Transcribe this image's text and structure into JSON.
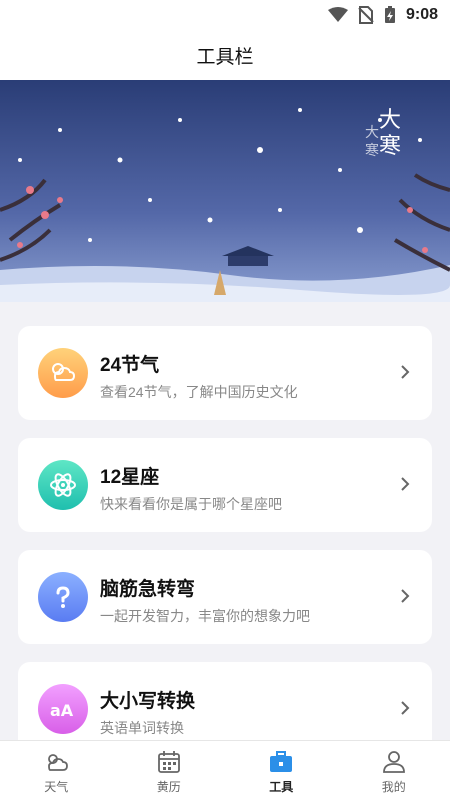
{
  "status_bar": {
    "time": "9:08"
  },
  "header": {
    "title": "工具栏"
  },
  "banner": {
    "text_main": "大寒",
    "text_side": "大寒"
  },
  "tools": [
    {
      "title": "24节气",
      "subtitle": "查看24节气，了解中国历史文化",
      "icon": "weather-cloud-icon",
      "color_top": "#ffd27a",
      "color_bottom": "#ff9c4a"
    },
    {
      "title": "12星座",
      "subtitle": "快来看看你是属于哪个星座吧",
      "icon": "atom-icon",
      "color_top": "#5ee6c5",
      "color_bottom": "#1fbfae"
    },
    {
      "title": "脑筋急转弯",
      "subtitle": "一起开发智力，丰富你的想象力吧",
      "icon": "question-icon",
      "color_top": "#8bb0ff",
      "color_bottom": "#5a7cf2"
    },
    {
      "title": "大小写转换",
      "subtitle": "英语单词转换",
      "icon": "text-case-icon",
      "color_top": "#f2a0ff",
      "color_bottom": "#d85fe8"
    }
  ],
  "nav": {
    "items": [
      {
        "label": "天气",
        "icon": "weather-icon"
      },
      {
        "label": "黄历",
        "icon": "calendar-icon"
      },
      {
        "label": "工具",
        "icon": "toolbox-icon"
      },
      {
        "label": "我的",
        "icon": "profile-icon"
      }
    ],
    "active_index": 2,
    "active_color": "#2b8fe8"
  }
}
